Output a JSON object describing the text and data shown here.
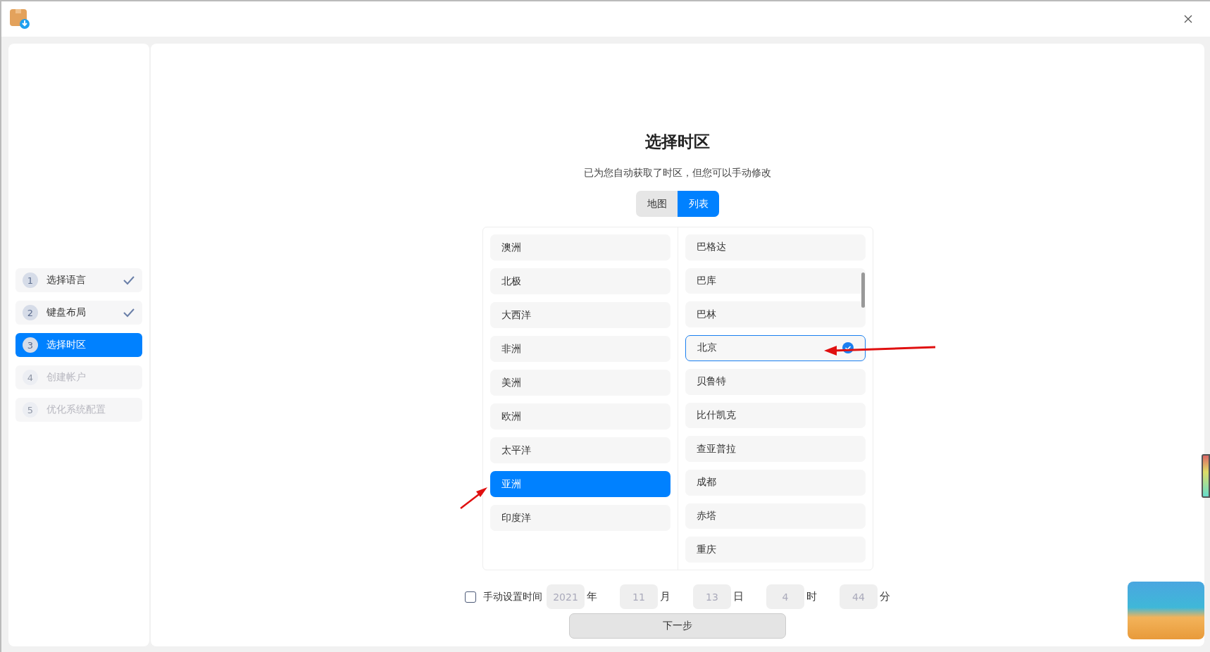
{
  "steps": [
    {
      "number": "1",
      "label": "选择语言",
      "done": true,
      "selected": false,
      "disabled": false
    },
    {
      "number": "2",
      "label": "键盘布局",
      "done": true,
      "selected": false,
      "disabled": false
    },
    {
      "number": "3",
      "label": "选择时区",
      "done": false,
      "selected": true,
      "disabled": false
    },
    {
      "number": "4",
      "label": "创建帐户",
      "done": false,
      "selected": false,
      "disabled": true
    },
    {
      "number": "5",
      "label": "优化系统配置",
      "done": false,
      "selected": false,
      "disabled": true
    }
  ],
  "title": "选择时区",
  "subtitle": "已为您自动获取了时区，但您可以手动修改",
  "view_toggle": [
    {
      "label": "地图",
      "selected": false
    },
    {
      "label": "列表",
      "selected": true
    }
  ],
  "regions": [
    {
      "label": "澳洲",
      "selected": false
    },
    {
      "label": "北极",
      "selected": false
    },
    {
      "label": "大西洋",
      "selected": false
    },
    {
      "label": "非洲",
      "selected": false
    },
    {
      "label": "美洲",
      "selected": false
    },
    {
      "label": "欧洲",
      "selected": false
    },
    {
      "label": "太平洋",
      "selected": false
    },
    {
      "label": "亚洲",
      "selected": true
    },
    {
      "label": "印度洋",
      "selected": false
    }
  ],
  "cities": [
    {
      "label": "巴格达",
      "selected": false
    },
    {
      "label": "巴库",
      "selected": false
    },
    {
      "label": "巴林",
      "selected": false
    },
    {
      "label": "北京",
      "selected": true
    },
    {
      "label": "贝鲁特",
      "selected": false
    },
    {
      "label": "比什凯克",
      "selected": false
    },
    {
      "label": "查亚普拉",
      "selected": false
    },
    {
      "label": "成都",
      "selected": false
    },
    {
      "label": "赤塔",
      "selected": false
    },
    {
      "label": "重庆",
      "selected": false
    }
  ],
  "manual_time": {
    "label": "手动设置时间",
    "checked": false,
    "fields": [
      {
        "value": "2021",
        "unit": "年"
      },
      {
        "value": "11",
        "unit": "月"
      },
      {
        "value": "13",
        "unit": "日"
      },
      {
        "value": "4",
        "unit": "时"
      },
      {
        "value": "44",
        "unit": "分"
      }
    ]
  },
  "next_button": "下一步"
}
